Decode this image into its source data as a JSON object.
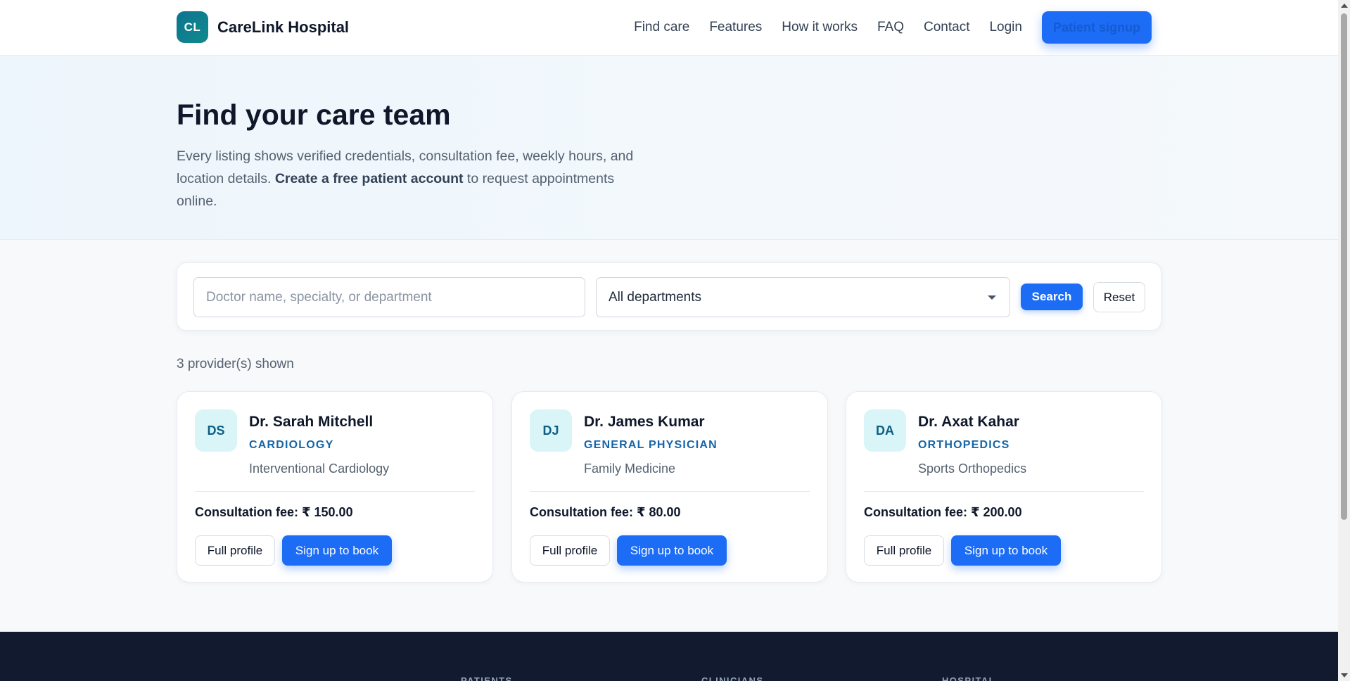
{
  "header": {
    "logo_text": "CL",
    "brand": "CareLink Hospital",
    "nav": [
      "Find care",
      "Features",
      "How it works",
      "FAQ",
      "Contact",
      "Login"
    ],
    "signup_label": "Patient signup"
  },
  "hero": {
    "title": "Find your care team",
    "desc_1": "Every listing shows verified credentials, consultation fee, weekly hours, and location details. ",
    "desc_bold": "Create a free patient account",
    "desc_2": " to request appointments online."
  },
  "search": {
    "placeholder": "Doctor name, specialty, or department",
    "value": "",
    "department": "All departments",
    "search_label": "Search",
    "reset_label": "Reset"
  },
  "results_count": "3 provider(s) shown",
  "providers": [
    {
      "initials": "DS",
      "name": "Dr. Sarah Mitchell",
      "department": "CARDIOLOGY",
      "specialty": "Interventional Cardiology",
      "fee": "Consultation fee: ₹ 150.00",
      "profile_label": "Full profile",
      "book_label": "Sign up to book"
    },
    {
      "initials": "DJ",
      "name": "Dr. James Kumar",
      "department": "GENERAL PHYSICIAN",
      "specialty": "Family Medicine",
      "fee": "Consultation fee: ₹ 80.00",
      "profile_label": "Full profile",
      "book_label": "Sign up to book"
    },
    {
      "initials": "DA",
      "name": "Dr. Axat Kahar",
      "department": "ORTHOPEDICS",
      "specialty": "Sports Orthopedics",
      "fee": "Consultation fee: ₹ 200.00",
      "profile_label": "Full profile",
      "book_label": "Sign up to book"
    }
  ],
  "footer": {
    "columns": [
      "PATIENTS",
      "CLINICIANS",
      "HOSPITAL"
    ]
  },
  "colors": {
    "accent": "#1c6cf5",
    "logo": "#0e7490",
    "department_text": "#1565a8",
    "footer_bg": "#111a2e"
  }
}
